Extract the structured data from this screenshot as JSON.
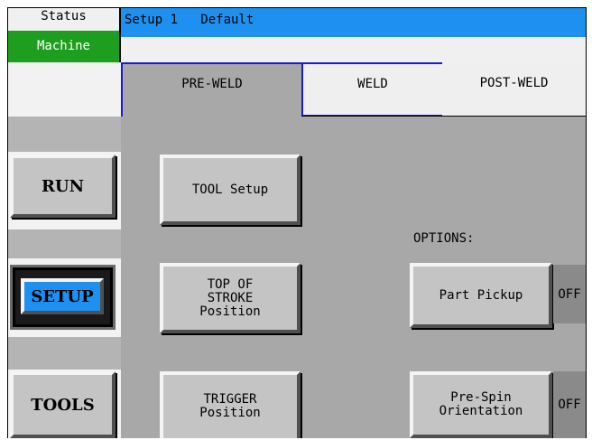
{
  "header": {
    "status_label": "Status",
    "machine_label": "Machine",
    "setup_title": "Setup 1   Default"
  },
  "tabs": [
    {
      "label": "PRE-WELD",
      "active": true
    },
    {
      "label": "WELD",
      "active": false
    },
    {
      "label": "POST-WELD",
      "active": false
    }
  ],
  "sidebar": {
    "run_label": "RUN",
    "setup_label": "SETUP",
    "tools_label": "TOOLS",
    "active": "SETUP"
  },
  "buttons": {
    "tool_setup": "TOOL Setup",
    "top_of_stroke": "TOP OF\nSTROKE\nPosition",
    "trigger": "TRIGGER\nPosition"
  },
  "options": {
    "label": "OPTIONS:",
    "items": [
      {
        "label": "Part Pickup",
        "state": "OFF"
      },
      {
        "label": "Pre-Spin\nOrientation",
        "state": "OFF"
      }
    ]
  },
  "colors": {
    "title_bar": "#1e90f0",
    "machine_status": "#1e9e1e",
    "tab_outline": "#1a1ad0",
    "panel": "#a8a8a8"
  }
}
